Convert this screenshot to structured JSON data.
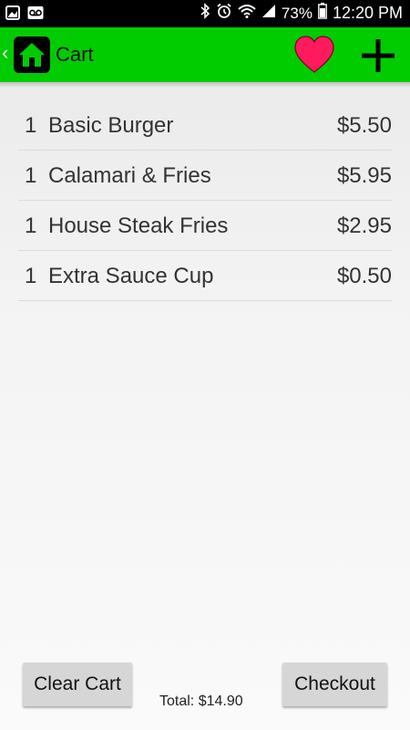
{
  "colors": {
    "action_bar": "#00cc00",
    "heart": "#ff1a5e",
    "status_bar": "#000000",
    "button_bg": "#d6d6d6"
  },
  "status_bar": {
    "icons_left": [
      "gallery-icon",
      "voicemail-icon"
    ],
    "icons_right": [
      "bluetooth-icon",
      "alarm-icon",
      "wifi-icon",
      "signal-icon",
      "battery-icon"
    ],
    "battery": "73%",
    "time": "12:20 PM"
  },
  "action_bar": {
    "back_glyph": "‹",
    "title": "Cart",
    "logo_icon": "home-icon",
    "favorite_icon": "heart-icon",
    "add_icon": "plus-icon"
  },
  "cart": {
    "items": [
      {
        "qty": "1",
        "name": "Basic Burger",
        "price": "$5.50"
      },
      {
        "qty": "1",
        "name": "Calamari & Fries",
        "price": "$5.95"
      },
      {
        "qty": "1",
        "name": "House Steak Fries",
        "price": "$2.95"
      },
      {
        "qty": "1",
        "name": "Extra Sauce Cup",
        "price": "$0.50"
      }
    ]
  },
  "footer": {
    "clear_label": "Clear Cart",
    "checkout_label": "Checkout",
    "total_text": "Total: $14.90"
  }
}
